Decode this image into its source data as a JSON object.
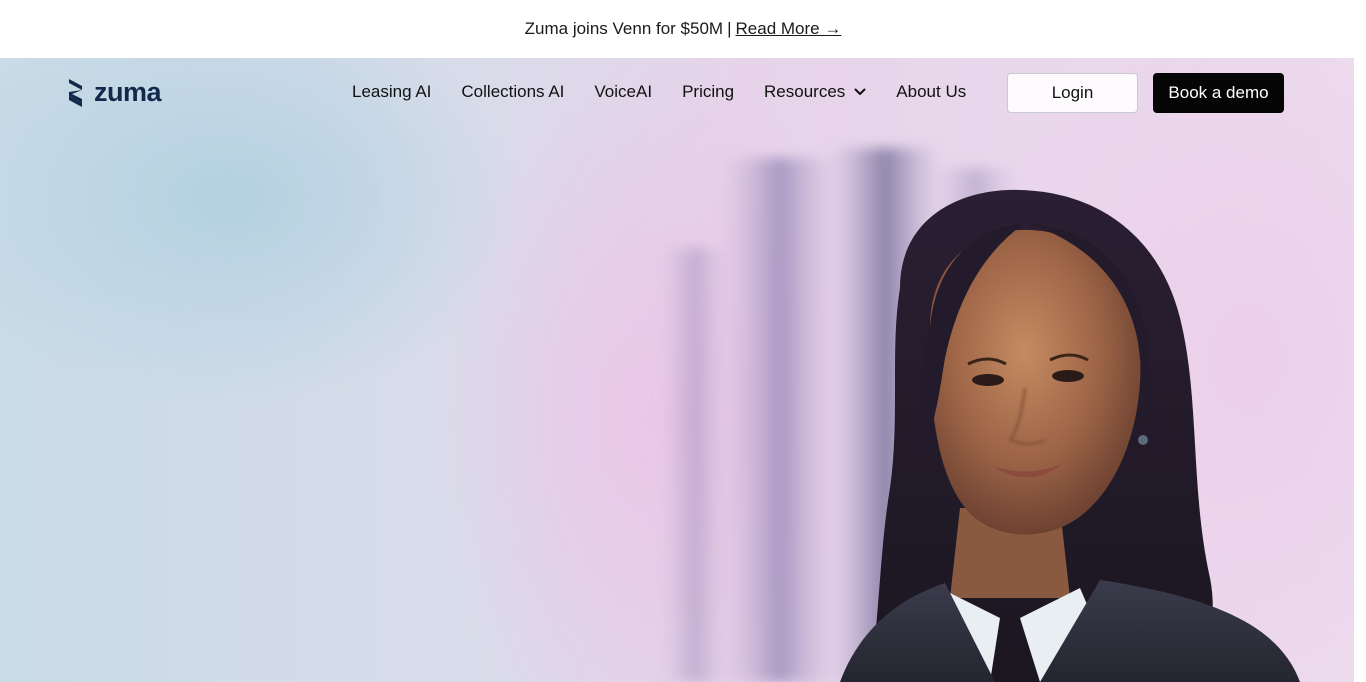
{
  "announcement": {
    "text": "Zuma joins Venn for $50M",
    "separator": "|",
    "link_label": "Read More →"
  },
  "nav": {
    "logo_text": "zuma",
    "links": [
      {
        "label": "Leasing AI"
      },
      {
        "label": "Collections AI"
      },
      {
        "label": "VoiceAI"
      },
      {
        "label": "Pricing"
      },
      {
        "label": "Resources",
        "has_dropdown": true
      },
      {
        "label": "About Us"
      }
    ],
    "login_label": "Login",
    "demo_label": "Book a demo"
  },
  "hero": {
    "image": "portrait-photo"
  },
  "colors": {
    "brand_navy": "#13294b",
    "cta_black": "#050505",
    "hero_blue": "#c8dbe6",
    "hero_pink": "#ecdcee"
  }
}
